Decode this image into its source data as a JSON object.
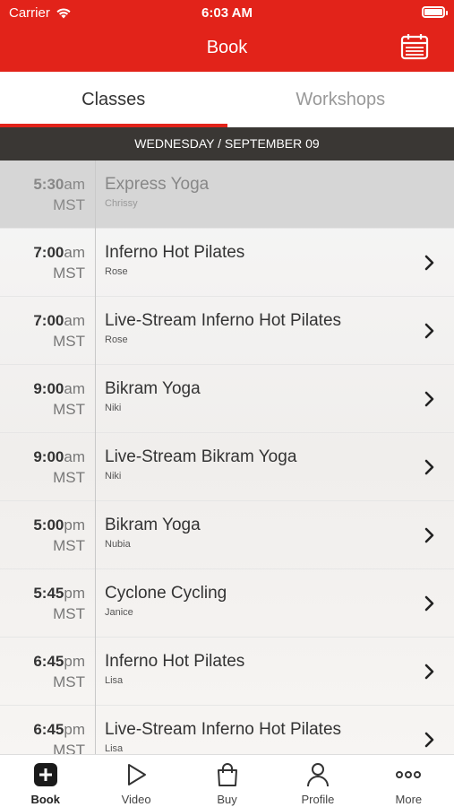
{
  "status_bar": {
    "carrier": "Carrier",
    "time": "6:03 AM",
    "battery_level": 1.0
  },
  "header": {
    "title": "Book",
    "calendar_icon": "calendar-icon"
  },
  "tabs": [
    {
      "label": "Classes",
      "active": true
    },
    {
      "label": "Workshops",
      "active": false
    }
  ],
  "date_banner": "WEDNESDAY / SEPTEMBER 09",
  "classes": [
    {
      "time": "5:30",
      "ampm": "am",
      "tz": "MST",
      "name": "Express Yoga",
      "instructor": "Chrissy",
      "past": true
    },
    {
      "time": "7:00",
      "ampm": "am",
      "tz": "MST",
      "name": "Inferno Hot Pilates",
      "instructor": "Rose",
      "past": false
    },
    {
      "time": "7:00",
      "ampm": "am",
      "tz": "MST",
      "name": "Live-Stream Inferno Hot Pilates",
      "instructor": "Rose",
      "past": false
    },
    {
      "time": "9:00",
      "ampm": "am",
      "tz": "MST",
      "name": "Bikram Yoga",
      "instructor": "Niki",
      "past": false
    },
    {
      "time": "9:00",
      "ampm": "am",
      "tz": "MST",
      "name": "Live-Stream Bikram Yoga",
      "instructor": "Niki",
      "past": false
    },
    {
      "time": "5:00",
      "ampm": "pm",
      "tz": "MST",
      "name": "Bikram Yoga",
      "instructor": "Nubia",
      "past": false
    },
    {
      "time": "5:45",
      "ampm": "pm",
      "tz": "MST",
      "name": "Cyclone Cycling",
      "instructor": "Janice",
      "past": false
    },
    {
      "time": "6:45",
      "ampm": "pm",
      "tz": "MST",
      "name": "Inferno Hot Pilates",
      "instructor": "Lisa",
      "past": false
    },
    {
      "time": "6:45",
      "ampm": "pm",
      "tz": "MST",
      "name": "Live-Stream Inferno Hot Pilates",
      "instructor": "Lisa",
      "past": false
    }
  ],
  "tab_bar": [
    {
      "label": "Book",
      "icon": "plus-square-icon",
      "active": true
    },
    {
      "label": "Video",
      "icon": "play-icon",
      "active": false
    },
    {
      "label": "Buy",
      "icon": "shopping-bag-icon",
      "active": false
    },
    {
      "label": "Profile",
      "icon": "person-icon",
      "active": false
    },
    {
      "label": "More",
      "icon": "more-dots-icon",
      "active": false
    }
  ],
  "colors": {
    "brand_red": "#e2231a",
    "date_banner_bg": "#3a3734"
  }
}
